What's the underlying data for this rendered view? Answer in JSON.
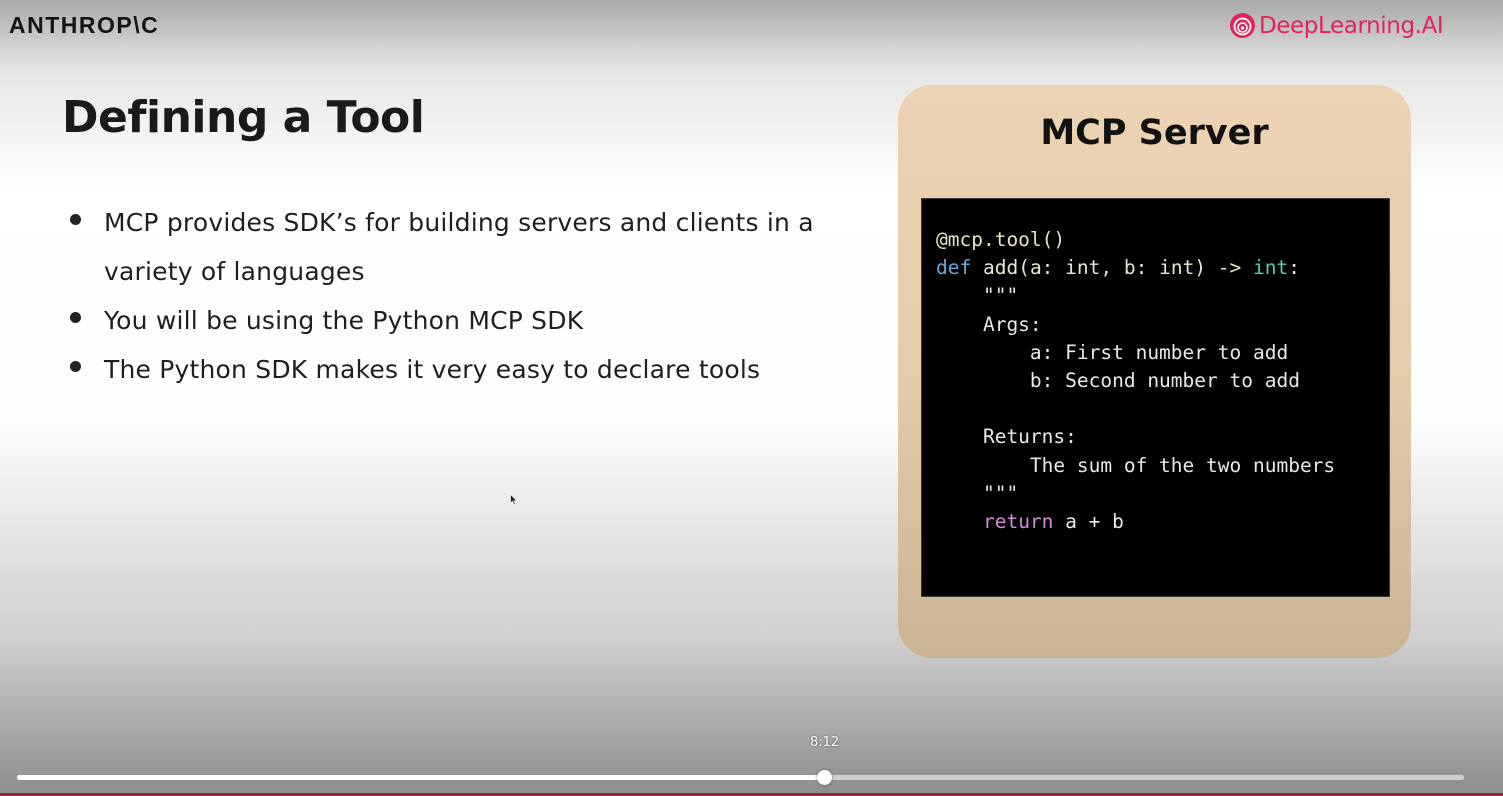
{
  "header": {
    "left_logo": "ANTHROP\\C",
    "right_logo": "DeepLearning.AI",
    "brand_color": "#e0245a"
  },
  "slide": {
    "title": "Defining a Tool",
    "bullets": [
      "MCP provides SDK’s for building servers and clients in a variety of languages",
      "You will be using the Python MCP SDK",
      "The Python SDK makes it very easy to declare tools"
    ]
  },
  "server_card": {
    "title": "MCP Server",
    "code": {
      "decorator": "@mcp.tool()",
      "def_kw": "def",
      "signature": "add(a: int, b: int) -> ",
      "return_type": "int",
      "sig_end": ":",
      "docstring_lines": [
        "    \"\"\"",
        "    Args:",
        "        a: First number to add",
        "        b: Second number to add",
        "",
        "    Returns:",
        "        The sum of the two numbers",
        "    \"\"\""
      ],
      "return_indent": "    ",
      "return_kw": "return",
      "return_expr": " a + b"
    }
  },
  "player": {
    "time_tooltip": "8:12",
    "progress_percent": 55.8
  }
}
